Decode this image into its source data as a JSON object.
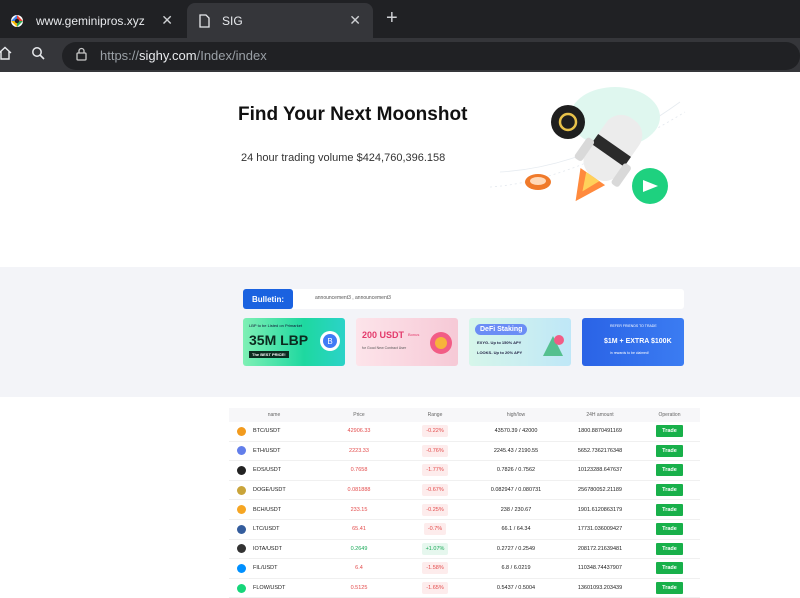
{
  "browser": {
    "tabs": [
      {
        "title": "www.geminipros.xyz | Frau"
      },
      {
        "title": "SIG"
      }
    ],
    "url_scheme": "https://",
    "url_host": "sighy.com",
    "url_path": "/Index/index"
  },
  "hero": {
    "title": "Find Your Next Moonshot",
    "subtitle": "24 hour trading volume $424,760,396.158"
  },
  "bulletin": {
    "label": "Bulletin:",
    "text": "announcement3 , announcement3"
  },
  "banners": [
    {
      "line1": "LBP to be Listed on Primarket",
      "line2": "35M LBP",
      "line3": "The BEST PRICE!"
    },
    {
      "line1": "200 USDT",
      "line2": "Bonus",
      "line3": "for Good New Contract User"
    },
    {
      "line1": "DeFi Staking",
      "line2": "EXYG- Up to 150% APY",
      "line3": "LOOKS- Up to 20% APY"
    },
    {
      "line1": "REFER FRIENDS TO TRADE",
      "line2": "$1M + EXTRA $100K",
      "line3": "in rewards to be claimed!"
    }
  ],
  "table": {
    "headers": [
      "name",
      "Price",
      "Range",
      "high/low",
      "24H amount",
      "Operation"
    ],
    "trade_label": "Trade",
    "rows": [
      {
        "pair": "BTC/USDT",
        "price": "42906.33",
        "change": "-0.22%",
        "highlow": "43570.39 / 42000",
        "amount": "1800.8870491169",
        "up": false,
        "color": "#f29b1e"
      },
      {
        "pair": "ETH/USDT",
        "price": "2223.33",
        "change": "-0.76%",
        "highlow": "2245.43 / 2190.55",
        "amount": "5652.7362176348",
        "up": false,
        "color": "#627eea"
      },
      {
        "pair": "EOS/USDT",
        "price": "0.7658",
        "change": "-1.77%",
        "highlow": "0.7826 / 0.7562",
        "amount": "10123288.647637",
        "up": false,
        "color": "#222222"
      },
      {
        "pair": "DOGE/USDT",
        "price": "0.081888",
        "change": "-0.67%",
        "highlow": "0.082947 / 0.080731",
        "amount": "256780052.21189",
        "up": false,
        "color": "#c9a43a"
      },
      {
        "pair": "BCH/USDT",
        "price": "233.15",
        "change": "-0.25%",
        "highlow": "238 / 230.67",
        "amount": "1901.6120863179",
        "up": false,
        "color": "#f6a623"
      },
      {
        "pair": "LTC/USDT",
        "price": "65.41",
        "change": "-0.7%",
        "highlow": "66.1 / 64.34",
        "amount": "17731.036009427",
        "up": false,
        "color": "#345d9d"
      },
      {
        "pair": "IOTA/USDT",
        "price": "0.2649",
        "change": "+1.07%",
        "highlow": "0.2727 / 0.2549",
        "amount": "208172.21639481",
        "up": true,
        "color": "#333333"
      },
      {
        "pair": "FIL/USDT",
        "price": "6.4",
        "change": "-1.58%",
        "highlow": "6.8 / 6.0219",
        "amount": "110348.74437907",
        "up": false,
        "color": "#0090ff"
      },
      {
        "pair": "FLOW/USDT",
        "price": "0.5125",
        "change": "-1.65%",
        "highlow": "0.5437 / 0.5004",
        "amount": "13601093.203439",
        "up": false,
        "color": "#16d67a"
      }
    ]
  }
}
